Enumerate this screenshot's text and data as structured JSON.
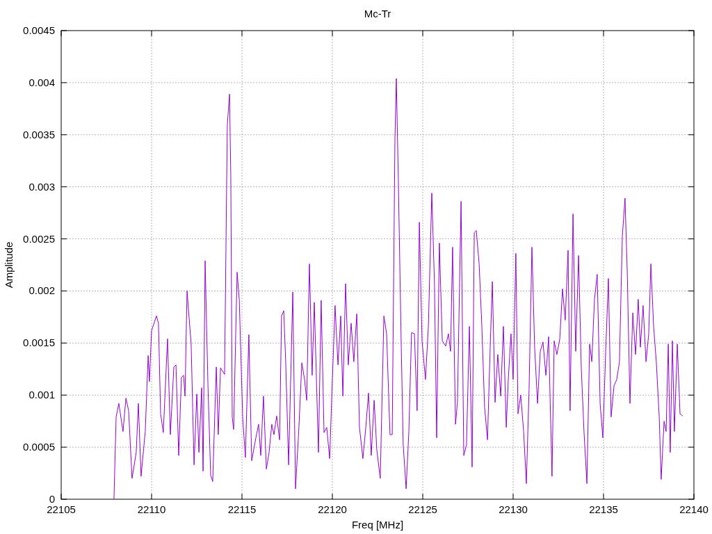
{
  "plot": {
    "chart_data": {
      "type": "line",
      "grid": true,
      "title": "Mc-Tr",
      "xlabel": "Freq [MHz]",
      "ylabel": "Amplitude",
      "xlim": [
        22105,
        22140
      ],
      "ylim": [
        0,
        0.0045
      ],
      "xticks": [
        22105,
        22110,
        22115,
        22120,
        22125,
        22130,
        22135,
        22140
      ],
      "yticks": [
        {
          "value": 0,
          "label": "0"
        },
        {
          "value": 0.0005,
          "label": "0.0005"
        },
        {
          "value": 0.001,
          "label": "0.001"
        },
        {
          "value": 0.0015,
          "label": "0.0015"
        },
        {
          "value": 0.002,
          "label": "0.002"
        },
        {
          "value": 0.0025,
          "label": "0.0025"
        },
        {
          "value": 0.003,
          "label": "0.003"
        },
        {
          "value": 0.0035,
          "label": "0.0035"
        },
        {
          "value": 0.004,
          "label": "0.004"
        },
        {
          "value": 0.0045,
          "label": "0.0045"
        }
      ],
      "x": [
        22107.92,
        22108.04,
        22108.19,
        22108.42,
        22108.58,
        22108.73,
        22108.92,
        22109.15,
        22109.27,
        22109.42,
        22109.65,
        22109.81,
        22109.88,
        22110.0,
        22110.27,
        22110.38,
        22110.5,
        22110.65,
        22110.88,
        22111.04,
        22111.23,
        22111.35,
        22111.5,
        22111.65,
        22111.77,
        22111.85,
        22111.96,
        22112.19,
        22112.35,
        22112.5,
        22112.62,
        22112.77,
        22112.85,
        22112.96,
        22113.12,
        22113.27,
        22113.38,
        22113.58,
        22113.69,
        22113.81,
        22114.04,
        22114.19,
        22114.31,
        22114.38,
        22114.46,
        22114.54,
        22114.73,
        22114.85,
        22115.04,
        22115.19,
        22115.38,
        22115.54,
        22115.77,
        22115.92,
        22116.04,
        22116.19,
        22116.35,
        22116.5,
        22116.65,
        22116.77,
        22116.92,
        22117.08,
        22117.19,
        22117.31,
        22117.42,
        22117.58,
        22117.81,
        22117.96,
        22118.15,
        22118.31,
        22118.46,
        22118.58,
        22118.73,
        22118.88,
        22119.0,
        22119.23,
        22119.38,
        22119.54,
        22119.69,
        22119.85,
        22120.0,
        22120.15,
        22120.31,
        22120.46,
        22120.58,
        22120.73,
        22120.88,
        22121.04,
        22121.19,
        22121.35,
        22121.5,
        22121.69,
        22121.85,
        22122.0,
        22122.15,
        22122.31,
        22122.46,
        22122.65,
        22122.85,
        22123.0,
        22123.19,
        22123.31,
        22123.46,
        22123.54,
        22123.65,
        22123.81,
        22123.92,
        22124.08,
        22124.23,
        22124.38,
        22124.54,
        22124.69,
        22124.81,
        22124.96,
        22125.15,
        22125.31,
        22125.5,
        22125.65,
        22125.77,
        22125.92,
        22126.08,
        22126.27,
        22126.42,
        22126.54,
        22126.65,
        22126.81,
        22126.92,
        22127.12,
        22127.27,
        22127.42,
        22127.58,
        22127.73,
        22127.85,
        22127.96,
        22128.12,
        22128.27,
        22128.42,
        22128.58,
        22128.73,
        22128.85,
        22129.0,
        22129.15,
        22129.31,
        22129.46,
        22129.62,
        22129.73,
        22129.88,
        22130.0,
        22130.15,
        22130.27,
        22130.42,
        22130.58,
        22130.73,
        22130.88,
        22131.04,
        22131.19,
        22131.35,
        22131.5,
        22131.65,
        22131.81,
        22131.96,
        22132.15,
        22132.27,
        22132.42,
        22132.58,
        22132.73,
        22132.88,
        22133.04,
        22133.15,
        22133.31,
        22133.46,
        22133.62,
        22133.77,
        22133.92,
        22134.08,
        22134.23,
        22134.35,
        22134.5,
        22134.65,
        22134.81,
        22134.96,
        22135.12,
        22135.27,
        22135.42,
        22135.58,
        22135.73,
        22135.88,
        22136.04,
        22136.19,
        22136.31,
        22136.46,
        22136.62,
        22136.77,
        22136.92,
        22137.04,
        22137.19,
        22137.35,
        22137.5,
        22137.62,
        22137.77,
        22137.92,
        22138.08,
        22138.19,
        22138.35,
        22138.46,
        22138.58,
        22138.69,
        22138.81,
        22138.92,
        22139.08,
        22139.23,
        22139.38
      ],
      "series": [
        {
          "color": "#9400d3",
          "values": [
            0,
            0.00079,
            0.00092,
            0.00065,
            0.00097,
            0.00085,
            0.0002,
            0.00045,
            0.00092,
            0.00022,
            0.00065,
            0.00138,
            0.00113,
            0.00162,
            0.00176,
            0.00169,
            0.00082,
            0.00064,
            0.00154,
            0.00062,
            0.00127,
            0.00129,
            0.00042,
            0.00117,
            0.00119,
            0.00099,
            0.002,
            0.00149,
            0.00033,
            0.00101,
            0.00045,
            0.00107,
            0.00027,
            0.00229,
            0.00109,
            0.00023,
            0.00017,
            0.00127,
            0.00062,
            0.00126,
            0.0012,
            0.00359,
            0.00389,
            0.00312,
            0.00079,
            0.00067,
            0.00218,
            0.00192,
            0.00079,
            0.0004,
            0.00158,
            0.00037,
            0.00059,
            0.00072,
            0.00042,
            0.00099,
            0.00029,
            0.00045,
            0.00072,
            0.00062,
            0.0008,
            0.00057,
            0.00176,
            0.00181,
            0.00132,
            0.00033,
            0.00199,
            0.0001,
            0.00069,
            0.00131,
            0.00115,
            0.00095,
            0.00226,
            0.00119,
            0.00189,
            0.00045,
            0.00191,
            0.00064,
            0.00069,
            0.00039,
            0.00115,
            0.00186,
            0.00129,
            0.00176,
            0.00099,
            0.00207,
            0.00129,
            0.00169,
            0.00132,
            0.00178,
            0.00069,
            0.00039,
            0.00069,
            0.00102,
            0.00042,
            0.00095,
            0.00047,
            0.0002,
            0.00176,
            0.00159,
            0.00062,
            0.00062,
            0.00346,
            0.00404,
            0.00306,
            0.00146,
            0.00052,
            0.0001,
            0.00065,
            0.0016,
            0.00159,
            0.00085,
            0.00266,
            0.00152,
            0.00115,
            0.00166,
            0.00294,
            0.00206,
            0.00059,
            0.00246,
            0.00152,
            0.00147,
            0.00159,
            0.00142,
            0.00242,
            0.00072,
            0.00093,
            0.00286,
            0.00042,
            0.00052,
            0.00166,
            0.00031,
            0.00256,
            0.00258,
            0.00226,
            0.00166,
            0.00089,
            0.00057,
            0.00146,
            0.00209,
            0.00093,
            0.00139,
            0.00099,
            0.00166,
            0.00069,
            0.00115,
            0.00159,
            0.00115,
            0.00236,
            0.00082,
            0.001,
            0.00065,
            0.00015,
            0.00105,
            0.00242,
            0.00146,
            0.00092,
            0.00142,
            0.00151,
            0.00119,
            0.00156,
            0.00022,
            0.00152,
            0.00139,
            0.00154,
            0.00202,
            0.00172,
            0.00239,
            0.00085,
            0.00274,
            0.00142,
            0.00234,
            0.00126,
            0.00065,
            0.00015,
            0.00149,
            0.00132,
            0.00192,
            0.00216,
            0.00092,
            0.00059,
            0.00142,
            0.00212,
            0.00079,
            0.00109,
            0.00115,
            0.00132,
            0.00252,
            0.00289,
            0.00219,
            0.00092,
            0.00179,
            0.00139,
            0.00192,
            0.00146,
            0.00186,
            0.00132,
            0.00159,
            0.00226,
            0.00166,
            0.00132,
            0.00079,
            0.00019,
            0.00075,
            0.00065,
            0.00149,
            0.00045,
            0.00152,
            0.00065,
            0.00149,
            0.00082,
            0.0008
          ]
        }
      ]
    }
  }
}
